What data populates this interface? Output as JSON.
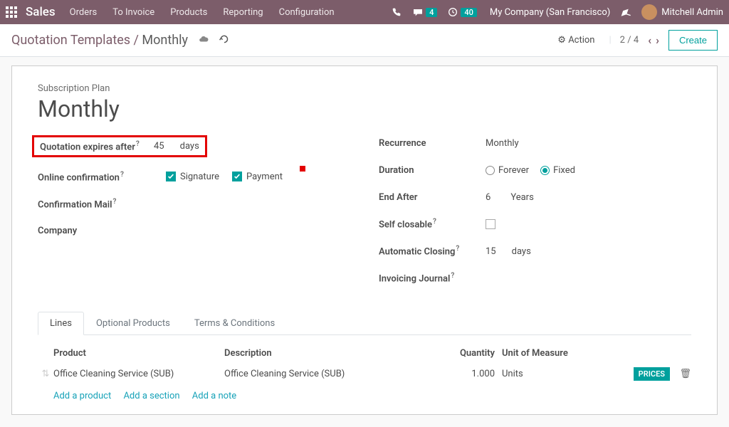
{
  "topbar": {
    "app_name": "Sales",
    "nav": [
      "Orders",
      "To Invoice",
      "Products",
      "Reporting",
      "Configuration"
    ],
    "msg_badge": "4",
    "clock_badge": "40",
    "company": "My Company (San Francisco)",
    "user": "Mitchell Admin"
  },
  "breadcrumb": {
    "parent": "Quotation Templates",
    "current": "Monthly"
  },
  "action_label": "Action",
  "pager": {
    "current": "2",
    "total": "4"
  },
  "create_label": "Create",
  "sheet": {
    "label": "Subscription Plan",
    "title": "Monthly",
    "left": {
      "expires_label": "Quotation expires after",
      "expires_value": "45",
      "expires_unit": "days",
      "online_label": "Online confirmation",
      "signature": "Signature",
      "payment": "Payment",
      "confirm_mail": "Confirmation Mail",
      "company": "Company"
    },
    "right": {
      "recurrence_label": "Recurrence",
      "recurrence_value": "Monthly",
      "duration_label": "Duration",
      "forever": "Forever",
      "fixed": "Fixed",
      "end_after_label": "End After",
      "end_after_value": "6",
      "end_after_unit": "Years",
      "self_closable": "Self closable",
      "auto_closing_label": "Automatic Closing",
      "auto_closing_value": "15",
      "auto_closing_unit": "days",
      "invoicing_journal": "Invoicing Journal"
    }
  },
  "tabs": [
    "Lines",
    "Optional Products",
    "Terms & Conditions"
  ],
  "table": {
    "headers": {
      "product": "Product",
      "description": "Description",
      "quantity": "Quantity",
      "uom": "Unit of Measure"
    },
    "row": {
      "product": "Office Cleaning Service (SUB)",
      "description": "Office Cleaning Service (SUB)",
      "quantity": "1.000",
      "uom": "Units",
      "tag": "PRICES"
    },
    "add_product": "Add a product",
    "add_section": "Add a section",
    "add_note": "Add a note"
  }
}
